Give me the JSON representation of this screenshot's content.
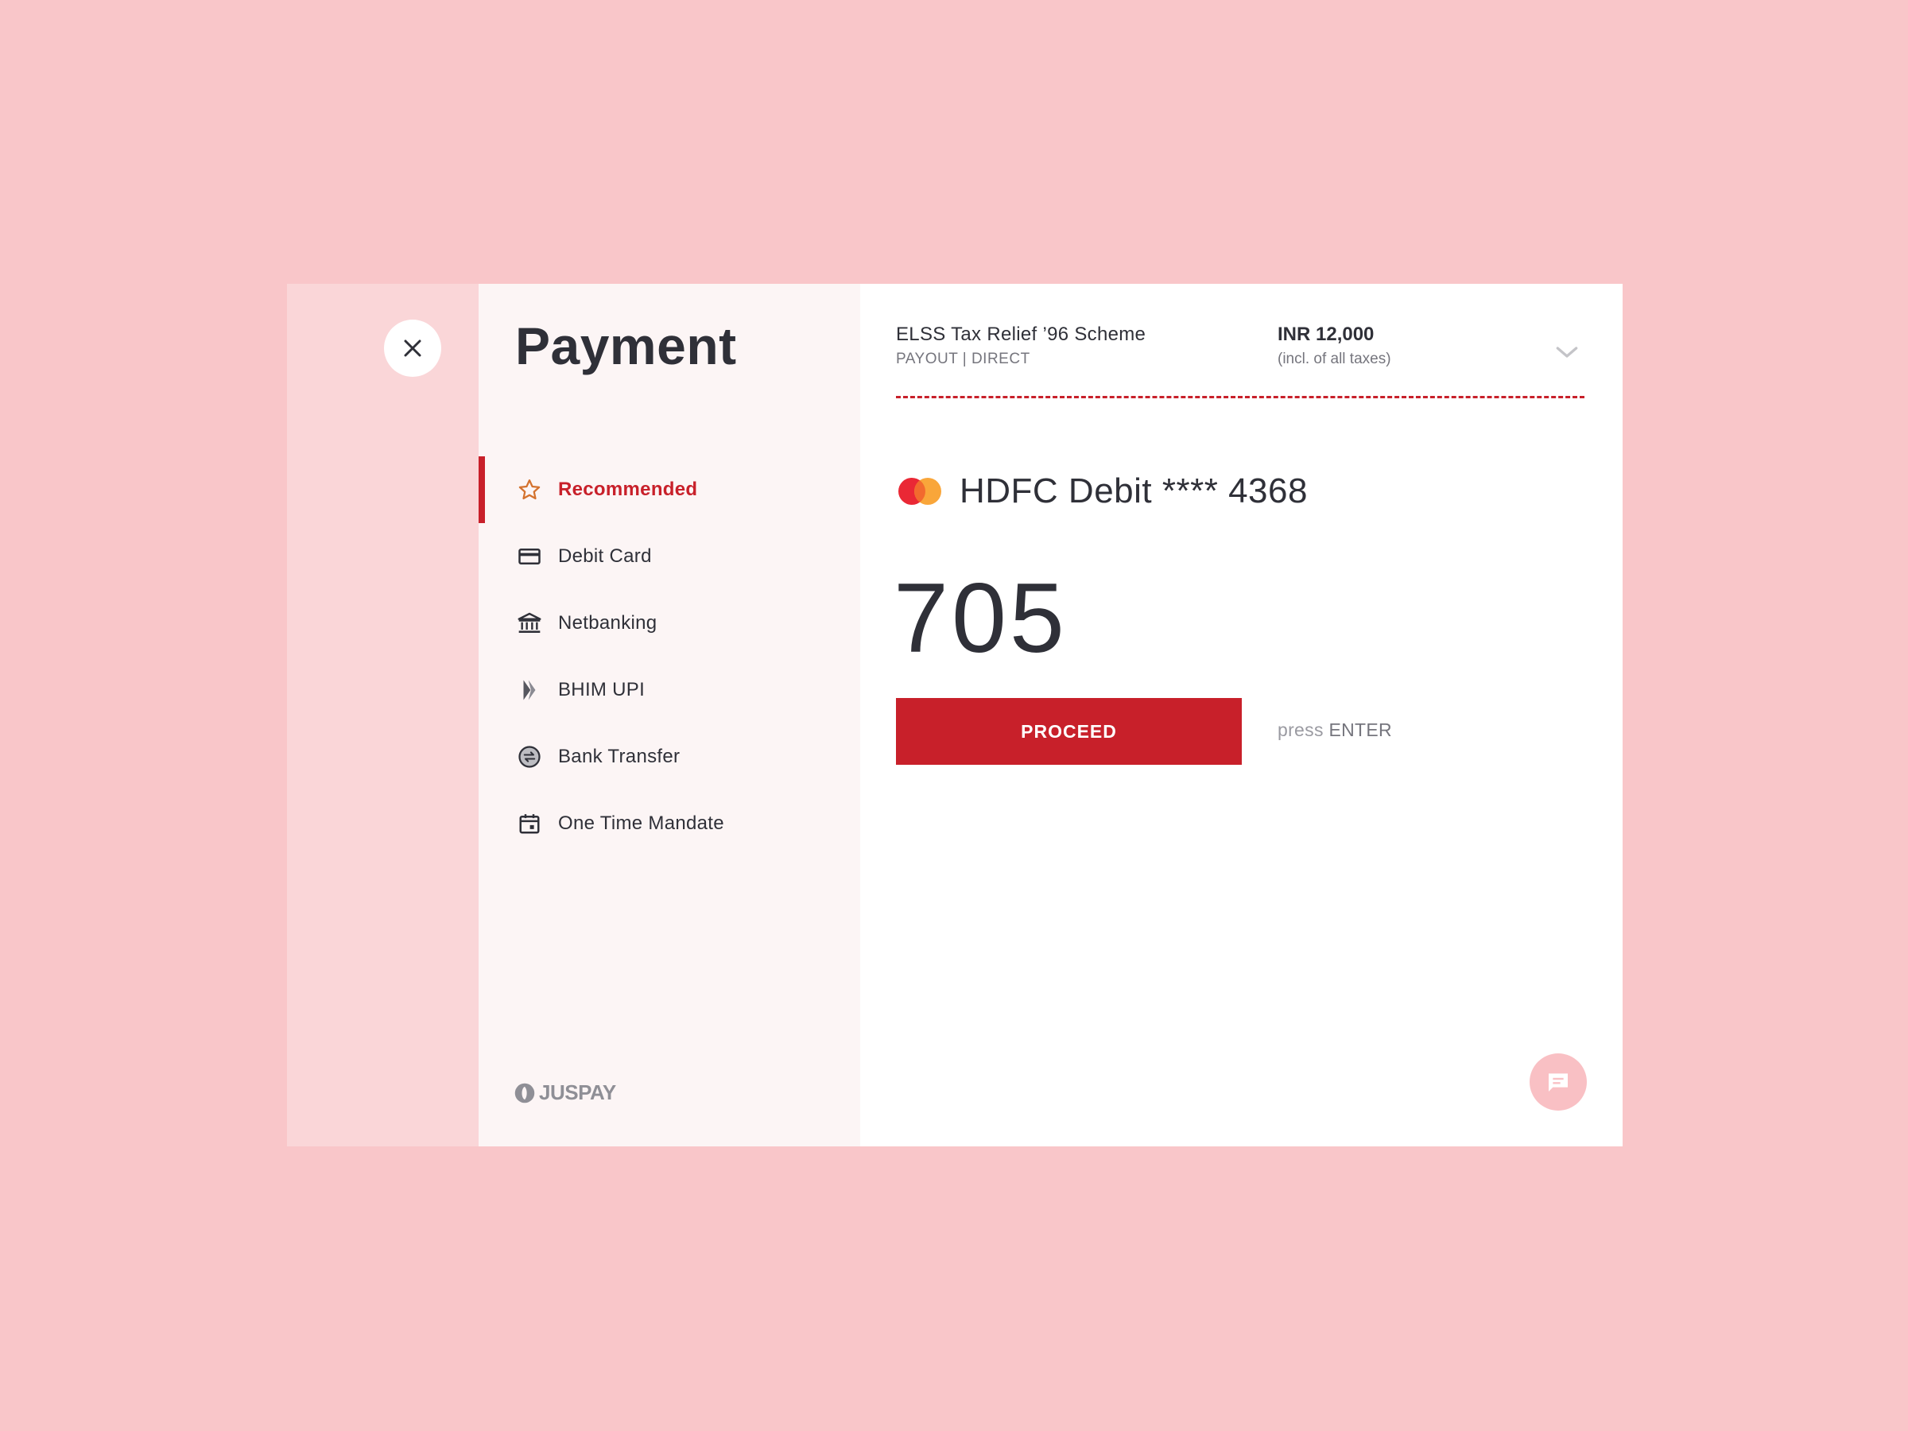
{
  "page": {
    "title": "Payment"
  },
  "close_button": {
    "icon": "close-icon"
  },
  "sidebar": {
    "items": [
      {
        "label": "Recommended",
        "icon": "star-icon",
        "active": true
      },
      {
        "label": "Debit Card",
        "icon": "card-icon",
        "active": false
      },
      {
        "label": "Netbanking",
        "icon": "bank-icon",
        "active": false
      },
      {
        "label": "BHIM UPI",
        "icon": "upi-icon",
        "active": false
      },
      {
        "label": "Bank Transfer",
        "icon": "transfer-icon",
        "active": false
      },
      {
        "label": "One Time Mandate",
        "icon": "calendar-icon",
        "active": false
      }
    ],
    "brand": "JUSPAY"
  },
  "order": {
    "scheme_name": "ELSS Tax Relief ’96 Scheme",
    "scheme_sub": "PAYOUT | DIRECT",
    "amount": "INR 12,000",
    "amount_note": "(incl. of all taxes)"
  },
  "card": {
    "label": "HDFC Debit **** 4368",
    "network_icon": "mastercard-icon"
  },
  "cvv": {
    "value": "705"
  },
  "proceed": {
    "label": "PROCEED"
  },
  "hint": {
    "prefix": "press ",
    "key": "ENTER"
  },
  "colors": {
    "background": "#f9c6c9",
    "rail": "#fad6d8",
    "sidebar": "#fcf5f5",
    "accent": "#c8202a",
    "text": "#2f3038"
  }
}
